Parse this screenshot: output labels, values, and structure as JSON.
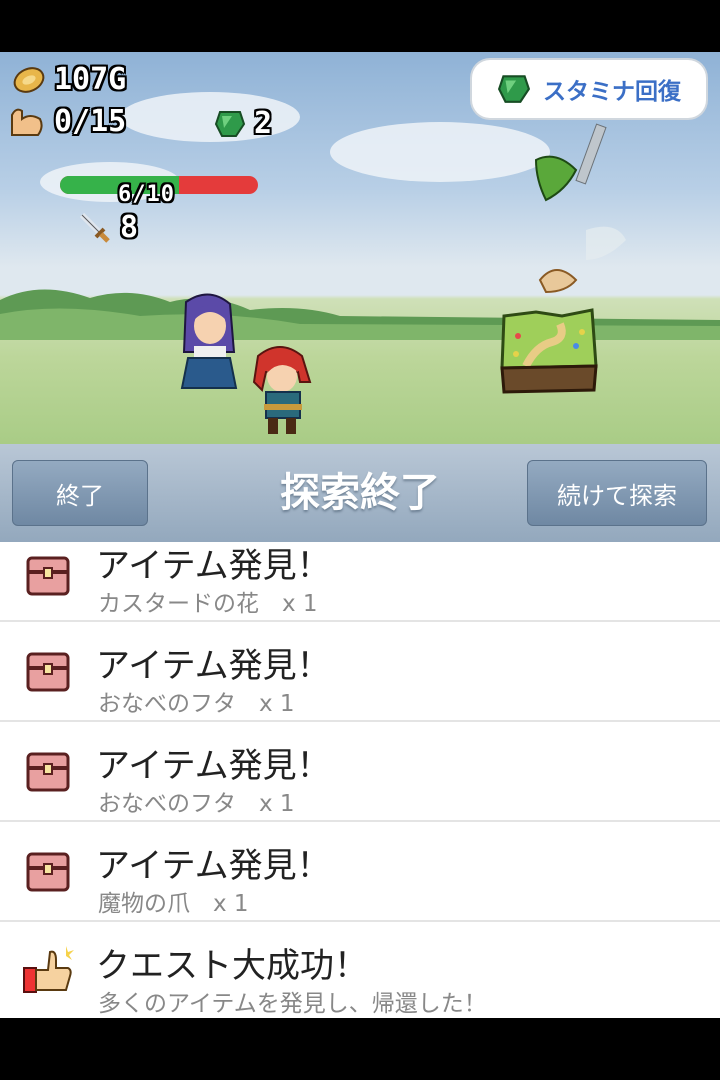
{
  "hud": {
    "gold": "107G",
    "stamina": "0/15",
    "gems": "2",
    "stamina_recover_label": "スタミナ回復",
    "hp_text": "6/10",
    "hp_fraction": 0.6,
    "attack": "8"
  },
  "toolbar": {
    "end_label": "終了",
    "title": "探索終了",
    "continue_label": "続けて探索"
  },
  "log": [
    {
      "title": "アイテム発見！",
      "detail": "カスタードの花　x 1",
      "icon": "treasure-chest-icon"
    },
    {
      "title": "アイテム発見！",
      "detail": "おなべのフタ　x 1",
      "icon": "treasure-chest-icon"
    },
    {
      "title": "アイテム発見！",
      "detail": "おなべのフタ　x 1",
      "icon": "treasure-chest-icon"
    },
    {
      "title": "アイテム発見！",
      "detail": "魔物の爪　x 1",
      "icon": "treasure-chest-icon"
    },
    {
      "title": "クエスト大成功！",
      "detail": "多くのアイテムを発見し、帰還した！",
      "icon": "thumbs-up-icon"
    }
  ],
  "colors": {
    "hp_fill": "#36b24a",
    "hp_empty": "#e43b3b",
    "accent": "#3b6fc6"
  }
}
